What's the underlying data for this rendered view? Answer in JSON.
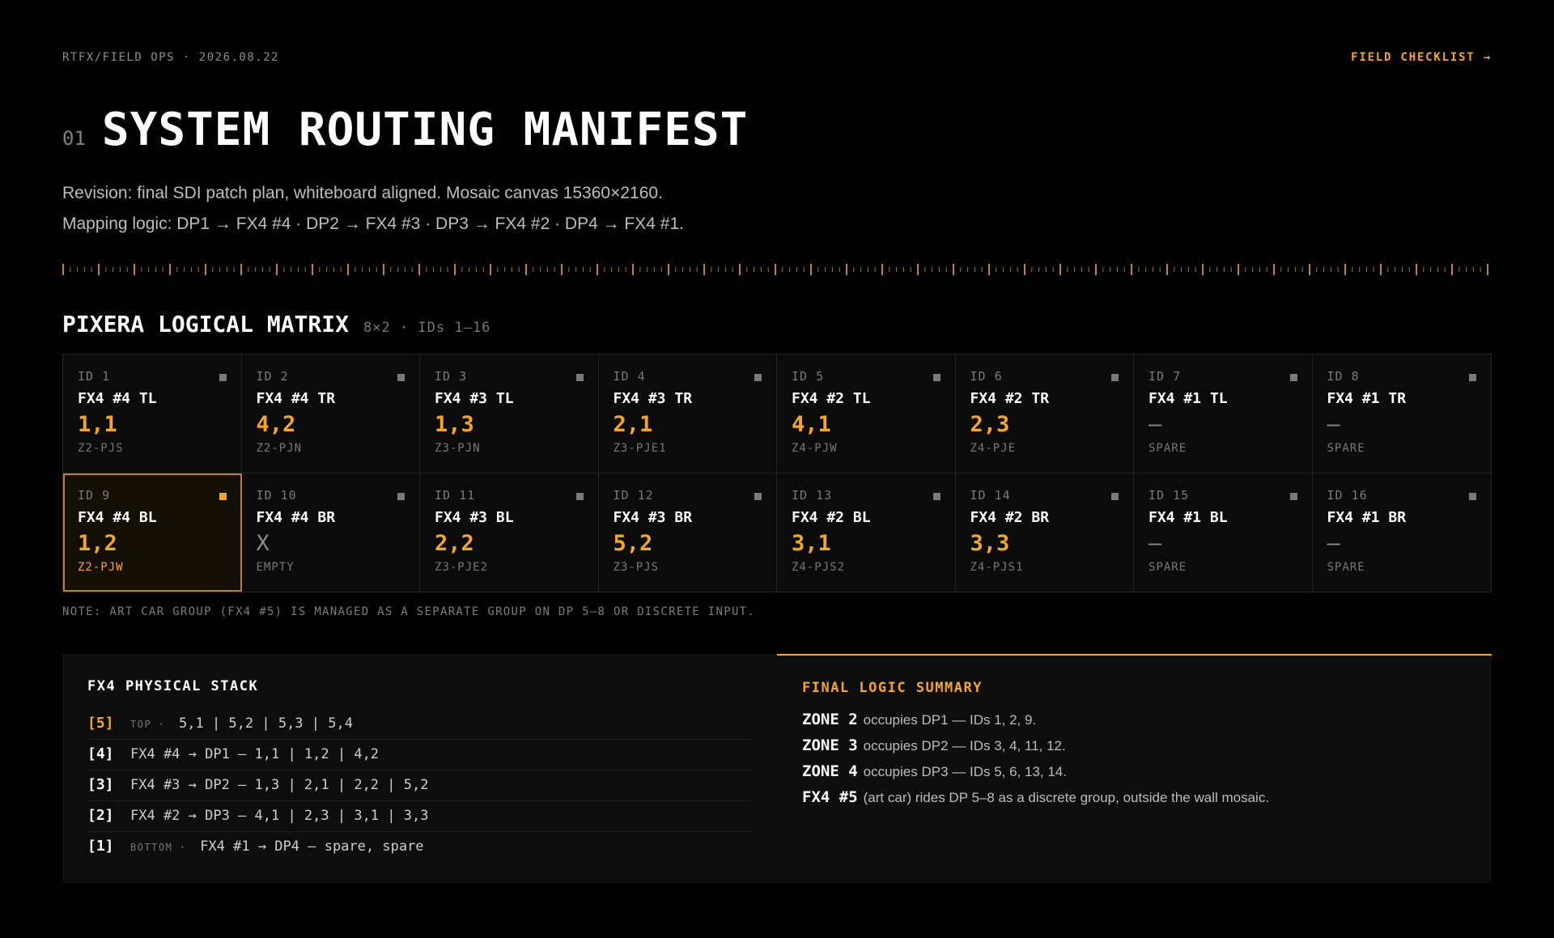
{
  "header": {
    "crumb": "RTFX/FIELD OPS · 2026.08.22",
    "checklist_link": "FIELD CHECKLIST →"
  },
  "title": {
    "number": "01",
    "text": "SYSTEM ROUTING MANIFEST"
  },
  "description": {
    "line1": "Revision: final SDI patch plan, whiteboard aligned. Mosaic canvas 15360×2160.",
    "line2": "Mapping logic: DP1 → FX4 #4 · DP2 → FX4 #3 · DP3 → FX4 #2 · DP4 → FX4 #1."
  },
  "matrix": {
    "title": "PIXERA LOGICAL MATRIX",
    "subtitle": "8×2 · IDs 1–16",
    "cells": [
      {
        "id": "ID 1",
        "name": "FX4 #4 TL",
        "coord": "1,1",
        "zone": "Z2-PJS"
      },
      {
        "id": "ID 2",
        "name": "FX4 #4 TR",
        "coord": "4,2",
        "zone": "Z2-PJN"
      },
      {
        "id": "ID 3",
        "name": "FX4 #3 TL",
        "coord": "1,3",
        "zone": "Z3-PJN"
      },
      {
        "id": "ID 4",
        "name": "FX4 #3 TR",
        "coord": "2,1",
        "zone": "Z3-PJE1"
      },
      {
        "id": "ID 5",
        "name": "FX4 #2 TL",
        "coord": "4,1",
        "zone": "Z4-PJW"
      },
      {
        "id": "ID 6",
        "name": "FX4 #2 TR",
        "coord": "2,3",
        "zone": "Z4-PJE"
      },
      {
        "id": "ID 7",
        "name": "FX4 #1 TL",
        "coord": "—",
        "zone": "SPARE"
      },
      {
        "id": "ID 8",
        "name": "FX4 #1 TR",
        "coord": "—",
        "zone": "SPARE"
      },
      {
        "id": "ID 9",
        "name": "FX4 #4 BL",
        "coord": "1,2",
        "zone": "Z2-PJW"
      },
      {
        "id": "ID 10",
        "name": "FX4 #4 BR",
        "coord": "X",
        "zone": "EMPTY"
      },
      {
        "id": "ID 11",
        "name": "FX4 #3 BL",
        "coord": "2,2",
        "zone": "Z3-PJE2"
      },
      {
        "id": "ID 12",
        "name": "FX4 #3 BR",
        "coord": "5,2",
        "zone": "Z3-PJS"
      },
      {
        "id": "ID 13",
        "name": "FX4 #2 BL",
        "coord": "3,1",
        "zone": "Z4-PJS2"
      },
      {
        "id": "ID 14",
        "name": "FX4 #2 BR",
        "coord": "3,3",
        "zone": "Z4-PJS1"
      },
      {
        "id": "ID 15",
        "name": "FX4 #1 BL",
        "coord": "—",
        "zone": "SPARE"
      },
      {
        "id": "ID 16",
        "name": "FX4 #1 BR",
        "coord": "—",
        "zone": "SPARE"
      }
    ],
    "note": "NOTE: ART CAR GROUP (FX4 #5) IS MANAGED AS A SEPARATE GROUP ON DP 5–8 OR DISCRETE INPUT."
  },
  "stack": {
    "title": "FX4 PHYSICAL STACK",
    "rows": [
      {
        "slot": "[5]",
        "tag": "TOP",
        "text": "5,1 | 5,2 | 5,3 | 5,4"
      },
      {
        "slot": "[4]",
        "tag": "",
        "text": "FX4 #4 → DP1 — 1,1 | 1,2 | 4,2"
      },
      {
        "slot": "[3]",
        "tag": "",
        "text": "FX4 #3 → DP2 — 1,3 | 2,1 | 2,2 | 5,2"
      },
      {
        "slot": "[2]",
        "tag": "",
        "text": "FX4 #2 → DP3 — 4,1 | 2,3 | 3,1 | 3,3"
      },
      {
        "slot": "[1]",
        "tag": "BOTTOM",
        "text": "FX4 #1 → DP4 — spare, spare"
      }
    ]
  },
  "summary": {
    "title": "FINAL LOGIC SUMMARY",
    "rows": [
      {
        "key": "ZONE 2",
        "text": "occupies DP1 — IDs 1, 2, 9."
      },
      {
        "key": "ZONE 3",
        "text": "occupies DP2 — IDs 3, 4, 11, 12."
      },
      {
        "key": "ZONE 4",
        "text": "occupies DP3 — IDs 5, 6, 13, 14."
      },
      {
        "key": "FX4 #5",
        "text": "(art car) rides DP 5–8 as a discrete group, outside the wall mosaic."
      }
    ]
  },
  "colors": {
    "accent": "#f5a623",
    "background": "#000000",
    "panel": "#0d0d0d"
  }
}
